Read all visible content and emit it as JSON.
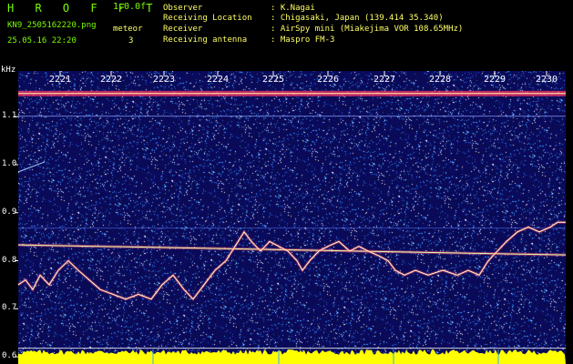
{
  "app": {
    "title": "H R O F F T",
    "version": "1.0.0f",
    "filename": "KN9_2505162220.png",
    "meteor_label": "meteor",
    "meteor_count": "3",
    "datetime": "25.05.16 22:20"
  },
  "info": [
    {
      "label": "Observer",
      "value": ": K.Nagai"
    },
    {
      "label": "Receiving Location",
      "value": ": Chigasaki, Japan (139.414 35.340)"
    },
    {
      "label": "Receiver",
      "value": ": AirSpy mini (Miakejima VOR 108.65MHz)"
    },
    {
      "label": "Receiving antenna",
      "value": ": Maspro FM-3"
    }
  ],
  "axis": {
    "y_unit": "kHz",
    "y_ticks": [
      {
        "value": 1.1,
        "label": "1.1"
      },
      {
        "value": 1.0,
        "label": "1.0"
      },
      {
        "value": 0.9,
        "label": "0.9"
      },
      {
        "value": 0.8,
        "label": "0.8"
      },
      {
        "value": 0.7,
        "label": "0.7"
      },
      {
        "value": 0.6,
        "label": "0.6"
      }
    ],
    "time_ticks": [
      "2221",
      "2222",
      "2223",
      "2224",
      "2225",
      "2226",
      "2227",
      "2228",
      "2229",
      "2230"
    ],
    "y_range_khz": [
      0.585,
      1.195
    ]
  },
  "colors": {
    "background": "#000000",
    "waterfall": "#0a0a5a",
    "header_green": "#7cfc00",
    "header_yellow": "#ffff66",
    "tick_text": "#ffffff",
    "signal_bar": "#ffff00"
  }
}
